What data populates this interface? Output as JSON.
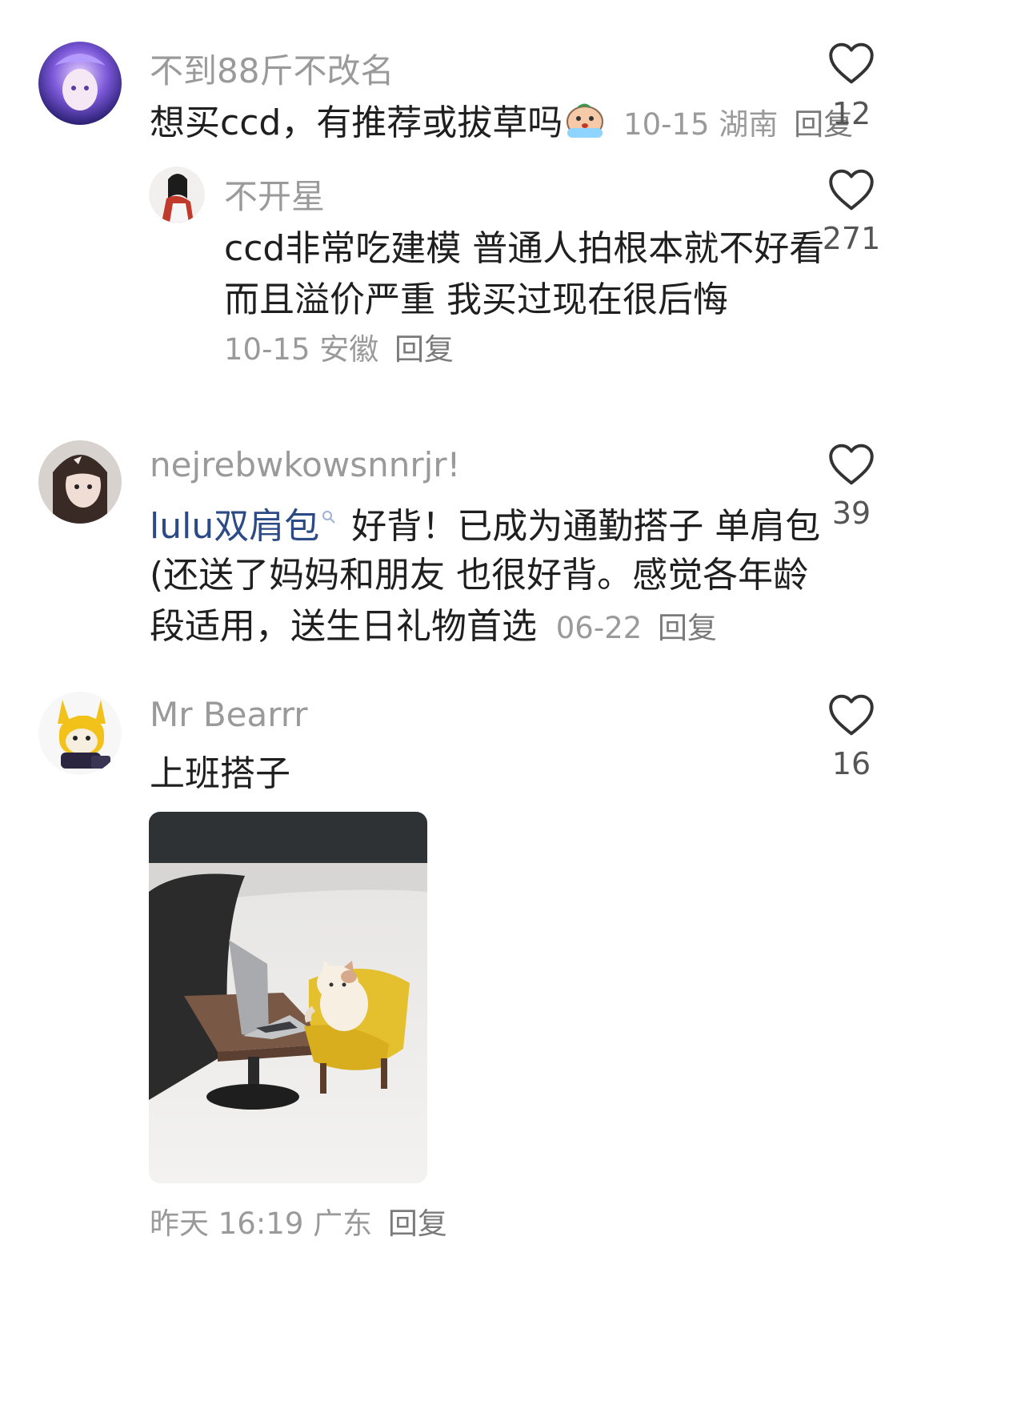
{
  "comments": [
    {
      "username": "不到88斤不改名",
      "text": "想买ccd，有推荐或拔草吗",
      "emoji": "crying-face-emoji",
      "date": "10-15",
      "location": "湖南",
      "reply": "回复",
      "likes": "12"
    },
    {
      "username": "不开星",
      "text_lines": [
        "ccd非常吃建模 普通人拍根本就不好看",
        "而且溢价严重 我买过现在很后悔"
      ],
      "date": "10-15",
      "location": "安徽",
      "reply": "回复",
      "likes": "271"
    },
    {
      "username": "nejrebwkowsnnrjr!",
      "link_text": "lulu双肩包",
      "text_lines": [
        "好背！已成为通勤搭子 单肩包",
        "(还送了妈妈和朋友 也很好背。感觉各年龄",
        "段适用，送生日礼物首选"
      ],
      "date": "06-22",
      "reply": "回复",
      "likes": "39"
    },
    {
      "username": "Mr Bearrr",
      "text": "上班搭子",
      "date": "昨天 16:19",
      "location": "广东",
      "reply": "回复",
      "likes": "16"
    }
  ],
  "icons": {
    "like": "heart-outline-icon",
    "search": "search-icon"
  },
  "colors": {
    "username": "#9a9a9a",
    "link": "#2c4a86",
    "text": "#1f1f1f"
  }
}
